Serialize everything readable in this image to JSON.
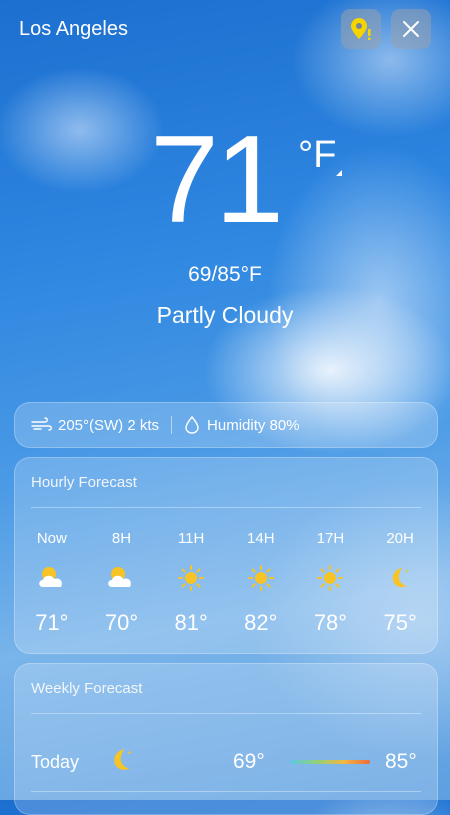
{
  "header": {
    "city": "Los Angeles"
  },
  "current": {
    "temp": "71",
    "unit": "°F",
    "range": "69/85°F",
    "condition": "Partly Cloudy"
  },
  "wind": {
    "text": "205°(SW) 2 kts",
    "humidity": "Humidity 80%"
  },
  "hourly": {
    "title": "Hourly Forecast",
    "items": [
      {
        "label": "Now",
        "icon": "partly-cloudy-icon",
        "temp": "71°"
      },
      {
        "label": "8H",
        "icon": "partly-cloudy-icon",
        "temp": "70°"
      },
      {
        "label": "11H",
        "icon": "sun-icon",
        "temp": "81°"
      },
      {
        "label": "14H",
        "icon": "sun-icon",
        "temp": "82°"
      },
      {
        "label": "17H",
        "icon": "sun-icon",
        "temp": "78°"
      },
      {
        "label": "20H",
        "icon": "moon-icon",
        "temp": "75°"
      }
    ]
  },
  "weekly": {
    "title": "Weekly Forecast",
    "days": [
      {
        "name": "Today",
        "icon": "moon-icon",
        "low": "69°",
        "high": "85°"
      }
    ]
  },
  "colors": {
    "sun": "#f7c325",
    "cloud": "#ffffff",
    "accent": "#f5d400"
  }
}
